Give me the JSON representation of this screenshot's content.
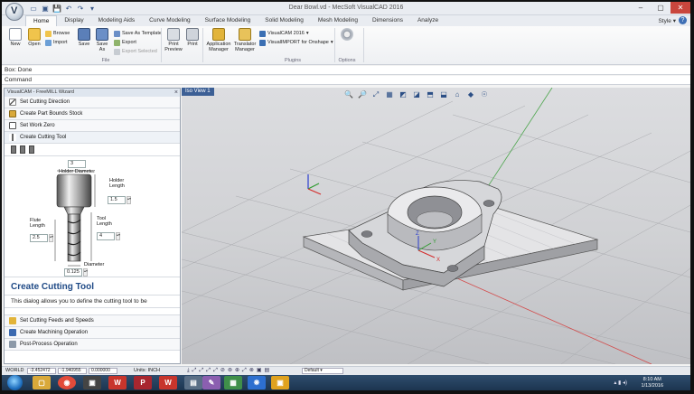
{
  "window": {
    "title": "Dear Bowl.vd - MecSoft VisualCAD 2016",
    "logo_letter": "V",
    "controls": [
      "–",
      "▢",
      "✕"
    ]
  },
  "quick_access": [
    "▭",
    "▣",
    "💾",
    "↶",
    "↷",
    "▾"
  ],
  "tabs": [
    "Home",
    "Display",
    "Modeling Aids",
    "Curve Modeling",
    "Surface Modeling",
    "Solid Modeling",
    "Mesh Modeling",
    "Dimensions",
    "Analyze"
  ],
  "style_menu": "Style",
  "ribbon": {
    "new": "New",
    "open": "Open",
    "browse": "Browse",
    "import": "Import",
    "save": "Save",
    "save_as": "Save As",
    "save_as_template": "Save As Template",
    "export": "Export",
    "export_selected": "Export Selected",
    "file_group": "File",
    "print_preview": "Print Preview",
    "print": "Print",
    "application_manager": "Application Manager",
    "translator_manager": "Translator Manager",
    "visualcam": "VisualCAM 2016",
    "visualimport": "VisualIMPORT for Onshape",
    "plugins_group": "Plugins",
    "options_group": "Options"
  },
  "box_status": "Box: Done",
  "command_label": "Command",
  "panel": {
    "title": "VisualCAM - FreeMILL Wizard",
    "close": "×",
    "steps_top": [
      "Set Cutting Direction",
      "Create Part Bounds Stock",
      "Set Work Zero",
      "Create Cutting Tool"
    ],
    "steps_bottom": [
      "Set Cutting Feeds and Speeds",
      "Create Machining Operation",
      "Post-Process Operation"
    ],
    "diagram": {
      "holder_diameter_label": "Holder Diameter",
      "holder_diameter_value": "3",
      "holder_length_label": "Holder Length",
      "holder_length_value": "1.5",
      "flute_length_label": "Flute Length",
      "flute_length_value": "2.5",
      "tool_length_label": "Tool Length",
      "tool_length_value": "4",
      "diameter_label": "Diameter",
      "diameter_value": "0.125"
    },
    "info_title": "Create Cutting Tool",
    "info_text": "This dialog allows you to define the cutting tool to be"
  },
  "viewport": {
    "label": "Iso View 1",
    "tools": [
      "🔍",
      "🔎",
      "⤢",
      "▦",
      "◩",
      "◪",
      "⬒",
      "⬓",
      "⌂",
      "◆",
      "☉"
    ]
  },
  "statusbar": {
    "world": "WORLD",
    "x": "-3.452472",
    "y": "-1.940955",
    "z": "0.000000",
    "units": "Units: INCH",
    "layer": "Default",
    "snap_tools": [
      "⤓",
      "⤢",
      "⤢",
      "⤢",
      "⤢",
      "⊘",
      "⊚",
      "⊕",
      "⤢",
      "⊗",
      "▣",
      "▤"
    ]
  },
  "taskbar": {
    "apps": [
      "▢",
      "◉",
      "▣",
      "W",
      "P",
      "W",
      "▤",
      "✎",
      "▦",
      "❋",
      "▣"
    ],
    "time": "8:10 AM",
    "date": "1/13/2016",
    "tray": "▴ ▮ ◂)"
  }
}
